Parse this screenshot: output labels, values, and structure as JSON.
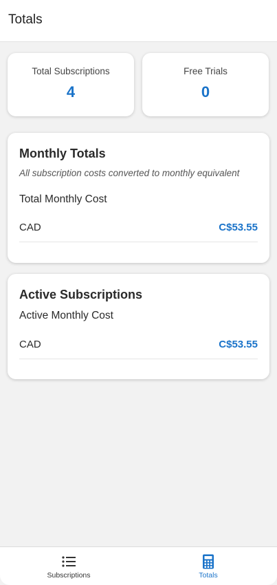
{
  "header": {
    "title": "Totals"
  },
  "stats": {
    "total_subscriptions": {
      "label": "Total Subscriptions",
      "value": "4"
    },
    "free_trials": {
      "label": "Free Trials",
      "value": "0"
    }
  },
  "monthly_totals": {
    "title": "Monthly Totals",
    "description": "All subscription costs converted to monthly equivalent",
    "subtitle": "Total Monthly Cost",
    "rows": [
      {
        "currency": "CAD",
        "amount": "C$53.55"
      }
    ]
  },
  "active_subscriptions": {
    "title": "Active Subscriptions",
    "subtitle": "Active Monthly Cost",
    "rows": [
      {
        "currency": "CAD",
        "amount": "C$53.55"
      }
    ]
  },
  "bottom_nav": {
    "items": [
      {
        "label": "Subscriptions",
        "icon": "list-icon",
        "active": false
      },
      {
        "label": "Totals",
        "icon": "calculator-icon",
        "active": true
      }
    ]
  },
  "colors": {
    "accent": "#1a73c9",
    "inactive": "#333333",
    "background": "#f2f2f2"
  }
}
